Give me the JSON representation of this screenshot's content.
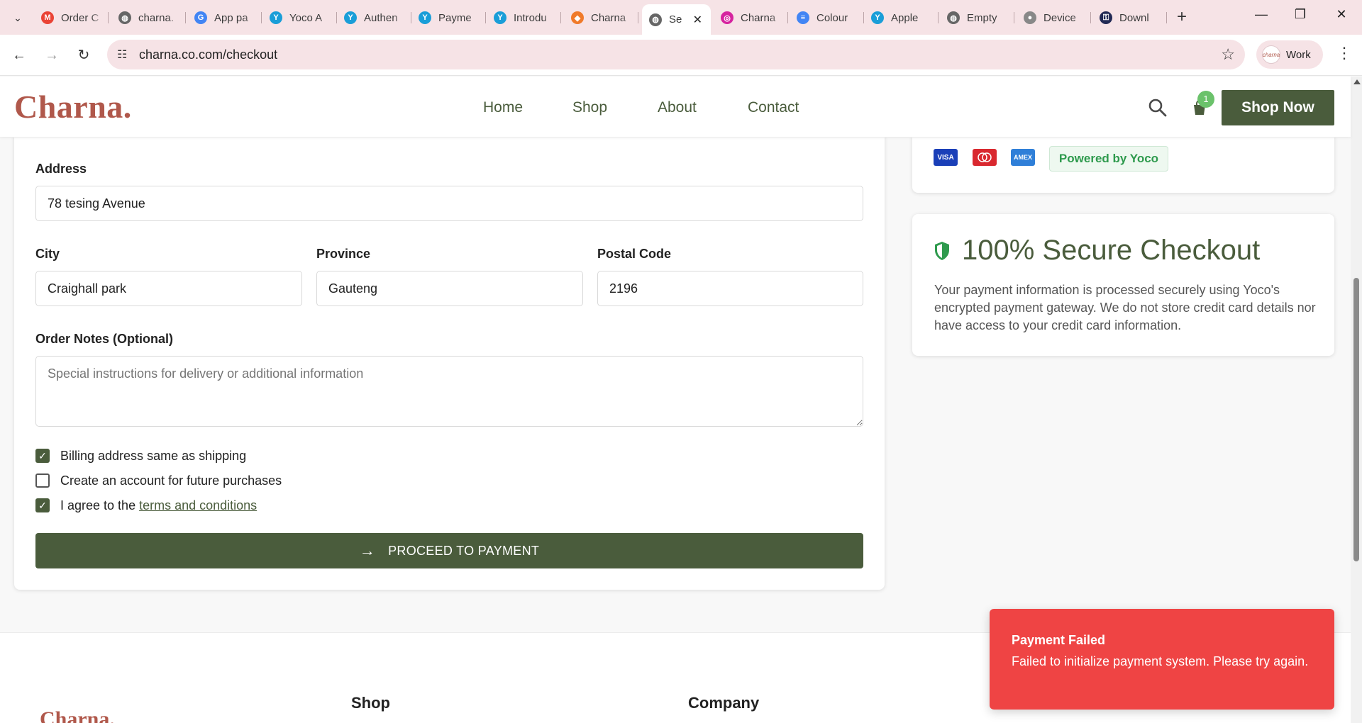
{
  "browser": {
    "tabs": [
      {
        "label": "Order C",
        "icon": "gmail-icon",
        "color": "#ea4335",
        "glyph": "M"
      },
      {
        "label": "charna.",
        "icon": "globe-icon",
        "color": "#666666",
        "glyph": "◍"
      },
      {
        "label": "App pa",
        "icon": "google-icon",
        "color": "#4285f4",
        "glyph": "G"
      },
      {
        "label": "Yoco A",
        "icon": "yoco-icon",
        "color": "#1a9ed8",
        "glyph": "Y"
      },
      {
        "label": "Authen",
        "icon": "yoco-icon",
        "color": "#1a9ed8",
        "glyph": "Y"
      },
      {
        "label": "Payme",
        "icon": "yoco-icon",
        "color": "#1a9ed8",
        "glyph": "Y"
      },
      {
        "label": "Introdu",
        "icon": "yoco-icon",
        "color": "#1a9ed8",
        "glyph": "Y"
      },
      {
        "label": "Charna",
        "icon": "figma-icon",
        "color": "#f07a2a",
        "glyph": "◆"
      },
      {
        "label": "Se",
        "icon": "globe-icon",
        "color": "#666666",
        "glyph": "◍",
        "active": true
      },
      {
        "label": "Charna",
        "icon": "instagram-icon",
        "color": "#d6249f",
        "glyph": "◎"
      },
      {
        "label": "Colour",
        "icon": "docs-icon",
        "color": "#4285f4",
        "glyph": "≡"
      },
      {
        "label": "Apple",
        "icon": "yoco-icon",
        "color": "#1a9ed8",
        "glyph": "Y"
      },
      {
        "label": "Empty",
        "icon": "globe-icon",
        "color": "#666666",
        "glyph": "◍"
      },
      {
        "label": "Device",
        "icon": "apple-icon",
        "color": "#888888",
        "glyph": "●"
      },
      {
        "label": "Downl",
        "icon": "lock-icon",
        "color": "#222a55",
        "glyph": "⚿"
      }
    ],
    "url": "charna.co.com/checkout",
    "profile_label": "Work",
    "profile_avatar_text": "charna"
  },
  "header": {
    "logo": "Charna.",
    "nav": [
      "Home",
      "Shop",
      "About",
      "Contact"
    ],
    "cart_count": "1",
    "cta": "Shop Now"
  },
  "form": {
    "address_label": "Address",
    "address_value": "78 tesing Avenue",
    "city_label": "City",
    "city_value": "Craighall park",
    "province_label": "Province",
    "province_value": "Gauteng",
    "postal_label": "Postal Code",
    "postal_value": "2196",
    "notes_label": "Order Notes (Optional)",
    "notes_placeholder": "Special instructions for delivery or additional information",
    "checkbox_billing": "Billing address same as shipping",
    "checkbox_account": "Create an account for future purchases",
    "checkbox_terms_prefix": "I agree to the",
    "checkbox_terms_link": "terms and conditions",
    "billing_checked": true,
    "account_checked": false,
    "terms_checked": true,
    "proceed_label": "PROCEED TO PAYMENT"
  },
  "payment": {
    "card_brands": [
      "VISA",
      "mastercard",
      "AMEX"
    ],
    "powered_by": "Powered by Yoco",
    "secure_title": "100% Secure Checkout",
    "secure_text": "Your payment information is processed securely using Yoco's encrypted payment gateway. We do not store credit card details nor have access to your credit card information."
  },
  "footer": {
    "logo": "Charna.",
    "headings": [
      "Shop",
      "Company"
    ]
  },
  "toast": {
    "title": "Payment Failed",
    "message": "Failed to initialize payment system. Please try again."
  },
  "colors": {
    "brand_green": "#4a5c3c",
    "brand_rust": "#b0584b",
    "error_red": "#ef4444",
    "badge_green": "#6bc26b",
    "tabstrip_pink": "#f6e3e6"
  }
}
